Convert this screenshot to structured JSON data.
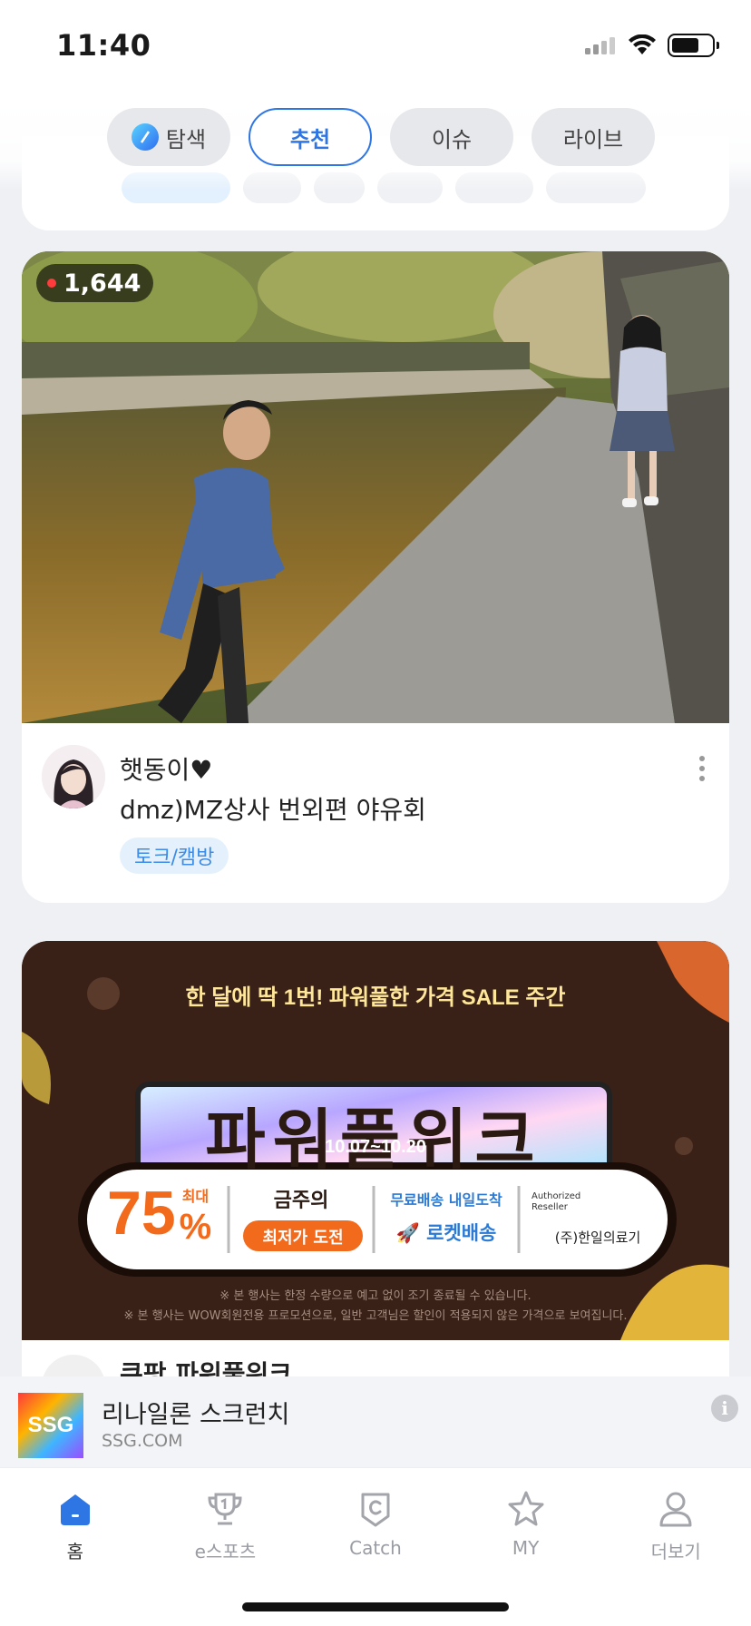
{
  "status_bar": {
    "time": "11:40"
  },
  "tabs": [
    {
      "label": "탐색",
      "icon": "compass-icon",
      "active": false
    },
    {
      "label": "추천",
      "active": true
    },
    {
      "label": "이슈",
      "active": false
    },
    {
      "label": "라이브",
      "active": false
    }
  ],
  "live_card": {
    "viewers": "1,644",
    "streamer": "햇동이♥",
    "title": "dmz)MZ상사 번외편 야유회",
    "category": "토크/캠방"
  },
  "ad_card": {
    "headline": "한 달에 딱 1번! 파워풀한 가격 SALE 주간",
    "event_title": "파워풀위크",
    "dates": "10.07~10.20",
    "discount_prefix": "75",
    "discount_suffix": "%",
    "discount_label": "최대",
    "lowest_price_top": "금주의",
    "lowest_price_bottom": "최저가 도전",
    "shipping_top": "무료배송 내일도착",
    "shipping_bottom": "로켓배송",
    "reseller_top": "Authorized Reseller",
    "reseller_bottom": "(주)한일의료기",
    "notice_1": "※ 본 행사는 한정 수량으로 예고 없이 조기 종료될 수 있습니다.",
    "notice_2": "※ 본 행사는 WOW회원전용 프로모션으로, 일반 고객님은 할인이 적용되지 않은 가격으로 보여집니다.",
    "card_title": "쿠팡 파워풀위크"
  },
  "bottom_ad": {
    "logo_text": "SSG",
    "title": "리나일론 스크런치",
    "subtitle": "SSG.COM",
    "info_label": "i"
  },
  "bottom_nav": [
    {
      "label": "홈",
      "icon": "home-icon",
      "active": true
    },
    {
      "label": "e스포츠",
      "icon": "trophy-icon",
      "active": false
    },
    {
      "label": "Catch",
      "icon": "catch-icon",
      "active": false
    },
    {
      "label": "MY",
      "icon": "star-icon",
      "active": false
    },
    {
      "label": "더보기",
      "icon": "person-icon",
      "active": false
    }
  ],
  "colors": {
    "accent": "#2f76e5",
    "live_dot": "#ff3b3b",
    "category_text": "#3d8ce6",
    "discount_orange": "#f26b1d",
    "ad_background": "#3a2118"
  }
}
